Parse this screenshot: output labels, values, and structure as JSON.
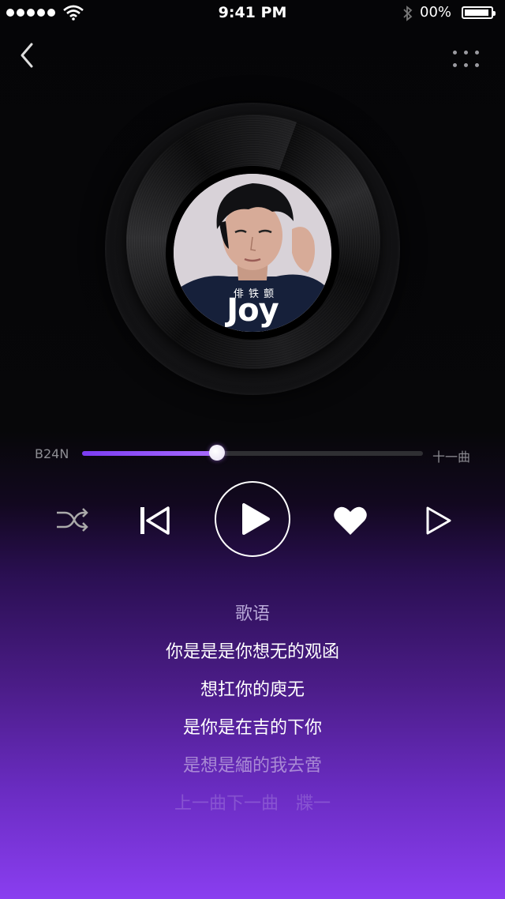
{
  "status_bar": {
    "time": "9:41 PM",
    "battery": "00%"
  },
  "icons": {
    "signal": "signal-dots-icon",
    "wifi": "wifi-icon",
    "bluetooth": "bluetooth-icon",
    "battery": "battery-icon",
    "back": "chevron-left-icon",
    "more": "more-dots-icon",
    "shuffle": "shuffle-icon",
    "previous": "skip-previous-icon",
    "play": "play-icon",
    "like": "heart-icon",
    "next": "next-icon"
  },
  "album": {
    "cover_text": "Joy",
    "cover_artist": "俳 铁 颤"
  },
  "progress": {
    "elapsed": "B24N",
    "remaining": "十一曲",
    "fraction": 0.395
  },
  "lyrics": {
    "title": "歌语",
    "lines": [
      "你是是是你想无的观函",
      "想扛你的庾无",
      "是你是在吉的下你",
      "是想是緬的我去啻",
      "上一曲下一曲　牃一"
    ],
    "opacities": [
      1,
      1,
      1,
      0.45,
      0.18
    ]
  },
  "colors": {
    "accent": "#8b46f5",
    "background_top": "#050507",
    "background_bottom": "#8a3ef0"
  }
}
